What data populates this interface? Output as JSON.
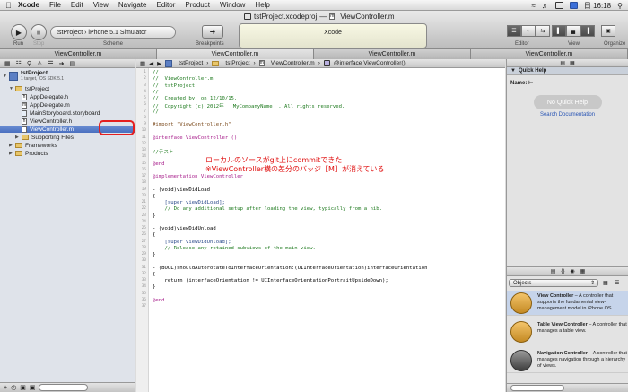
{
  "menubar": {
    "apple": "",
    "items": [
      "Xcode",
      "File",
      "Edit",
      "View",
      "Navigate",
      "Editor",
      "Product",
      "Window",
      "Help"
    ],
    "clock": "日 16:18"
  },
  "window": {
    "tabs": [
      "tstProject.xcodeproj",
      "ViewController.m"
    ],
    "separator": "—"
  },
  "toolbar": {
    "run_label": "Run",
    "stop_label": "Stop",
    "scheme_label": "Scheme",
    "scheme_value": "tstProject › iPhone 5.1 Simulator",
    "breakpoints_label": "Breakpoints",
    "activity_title": "Xcode",
    "editor_label": "Editor",
    "view_label": "View",
    "organizer_label": "Organize"
  },
  "tabs": [
    "ViewController.m",
    "ViewController.m",
    "ViewController.m",
    "ViewController.m"
  ],
  "navigator": {
    "project_name": "tstProject",
    "project_sub": "1 target, iOS SDK 5.1",
    "group_name": "tstProject",
    "files": [
      {
        "name": "AppDelegate.h",
        "badge": "h"
      },
      {
        "name": "AppDelegate.m",
        "badge": "m"
      },
      {
        "name": "MainStoryboard.storyboard",
        "badge": ""
      },
      {
        "name": "ViewController.h",
        "badge": "h"
      },
      {
        "name": "ViewController.m",
        "badge": "m"
      }
    ],
    "supporting": "Supporting Files",
    "frameworks": "Frameworks",
    "products": "Products"
  },
  "jumpbar": {
    "crumbs": [
      "tstProject",
      "tstProject",
      "ViewController.m",
      "@interface ViewController()"
    ]
  },
  "code": {
    "lines": [
      {
        "n": "1",
        "t": "//",
        "c": "c-com"
      },
      {
        "n": "2",
        "t": "//  ViewController.m",
        "c": "c-com"
      },
      {
        "n": "3",
        "t": "//  tstProject",
        "c": "c-com"
      },
      {
        "n": "4",
        "t": "//",
        "c": "c-com"
      },
      {
        "n": "5",
        "t": "//  Created by  on 12/10/15.",
        "c": "c-com"
      },
      {
        "n": "6",
        "t": "//  Copyright (c) 2012年 __MyCompanyName__. All rights reserved.",
        "c": "c-com"
      },
      {
        "n": "7",
        "t": "//",
        "c": "c-com"
      },
      {
        "n": "8",
        "t": "",
        "c": ""
      },
      {
        "n": "9",
        "t": "#import \"ViewController.h\"",
        "c": "c-pp"
      },
      {
        "n": "10",
        "t": "",
        "c": ""
      },
      {
        "n": "11",
        "t": "@interface ViewController ()",
        "c": "c-kw"
      },
      {
        "n": "12",
        "t": "",
        "c": ""
      },
      {
        "n": "13",
        "t": "//テスト",
        "c": "c-com"
      },
      {
        "n": "14",
        "t": "",
        "c": ""
      },
      {
        "n": "15",
        "t": "@end",
        "c": "c-kw"
      },
      {
        "n": "16",
        "t": "",
        "c": ""
      },
      {
        "n": "17",
        "t": "@implementation ViewController",
        "c": "c-kw"
      },
      {
        "n": "18",
        "t": "",
        "c": ""
      },
      {
        "n": "19",
        "t": "- (void)viewDidLoad",
        "c": ""
      },
      {
        "n": "20",
        "t": "{",
        "c": ""
      },
      {
        "n": "21",
        "t": "    [super viewDidLoad];",
        "c": "c-mth"
      },
      {
        "n": "22",
        "t": "    // Do any additional setup after loading the view, typically from a nib.",
        "c": "c-com"
      },
      {
        "n": "23",
        "t": "}",
        "c": ""
      },
      {
        "n": "24",
        "t": "",
        "c": ""
      },
      {
        "n": "25",
        "t": "- (void)viewDidUnload",
        "c": ""
      },
      {
        "n": "26",
        "t": "{",
        "c": ""
      },
      {
        "n": "27",
        "t": "    [super viewDidUnload];",
        "c": "c-mth"
      },
      {
        "n": "28",
        "t": "    // Release any retained subviews of the main view.",
        "c": "c-com"
      },
      {
        "n": "29",
        "t": "}",
        "c": ""
      },
      {
        "n": "30",
        "t": "",
        "c": ""
      },
      {
        "n": "31",
        "t": "- (BOOL)shouldAutorotateToInterfaceOrientation:(UIInterfaceOrientation)interfaceOrientation",
        "c": ""
      },
      {
        "n": "32",
        "t": "{",
        "c": ""
      },
      {
        "n": "33",
        "t": "    return (interfaceOrientation != UIInterfaceOrientationPortraitUpsideDown);",
        "c": ""
      },
      {
        "n": "34",
        "t": "}",
        "c": ""
      },
      {
        "n": "35",
        "t": "",
        "c": ""
      },
      {
        "n": "36",
        "t": "@end",
        "c": "c-kw"
      },
      {
        "n": "37",
        "t": "",
        "c": ""
      }
    ]
  },
  "annotation": {
    "line1": "ローカルのソースがgit上にcommitできた",
    "line2": "※ViewController横の差分のバッジ【M】が消えている"
  },
  "quick_help": {
    "title": "Quick Help",
    "name_label": "Name:",
    "name_value": "⊢",
    "empty": "No Quick Help",
    "search": "Search Documentation"
  },
  "library": {
    "selector": "Objects",
    "items": [
      {
        "title": "View Controller",
        "desc": " – A controller that supports the fundamental view-management model in iPhone OS."
      },
      {
        "title": "Table View Controller",
        "desc": " – A controller that manages a table view."
      },
      {
        "title": "Navigation Controller",
        "desc": " – A controller that manages navigation through a hierarchy of views."
      }
    ]
  },
  "colors": {
    "annotation": "#e01010",
    "highlight_box": "#e51f1f",
    "selection": "#4a6fbf"
  }
}
